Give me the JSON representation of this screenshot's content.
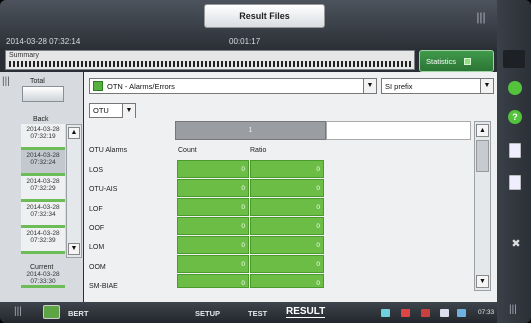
{
  "header": {
    "result_files_label": "Result Files",
    "start_timestamp": "2014-03-28 07:32:14",
    "elapsed": "00:01:17"
  },
  "summary": {
    "label": "Summary"
  },
  "statistics_button": {
    "label": "Statistics"
  },
  "history": {
    "total_label": "Total",
    "back_label": "Back",
    "items": [
      {
        "date": "2014-03-28",
        "time": "07:32:19"
      },
      {
        "date": "2014-03-28",
        "time": "07:32:24"
      },
      {
        "date": "2014-03-28",
        "time": "07:32:29"
      },
      {
        "date": "2014-03-28",
        "time": "07:32:34"
      },
      {
        "date": "2014-03-28",
        "time": "07:32:39"
      }
    ],
    "current_label": "Current",
    "current_date": "2014-03-28",
    "current_time": "07:33:30"
  },
  "selectors": {
    "category": "OTN - Alarms/Errors",
    "prefix": "SI prefix",
    "layer": "OTU"
  },
  "pager": {
    "page": "1"
  },
  "table": {
    "col_alarms": "OTU Alarms",
    "col_count": "Count",
    "col_ratio": "Ratio",
    "rows": [
      {
        "name": "LOS",
        "count": "0",
        "ratio": "0"
      },
      {
        "name": "OTU-AIS",
        "count": "0",
        "ratio": "0"
      },
      {
        "name": "LOF",
        "count": "0",
        "ratio": "0"
      },
      {
        "name": "OOF",
        "count": "0",
        "ratio": "0"
      },
      {
        "name": "LOM",
        "count": "0",
        "ratio": "0"
      },
      {
        "name": "OOM",
        "count": "0",
        "ratio": "0"
      },
      {
        "name": "SM-BIAE",
        "count": "0",
        "ratio": "0"
      }
    ]
  },
  "bottom": {
    "app_name": "BERT",
    "setup": "SETUP",
    "test": "TEST",
    "result": "RESULT",
    "clock": "07:33"
  },
  "colors": {
    "accent_green": "#6bbd45",
    "panel_bg": "#eef0f2",
    "chrome": "#2a2f36"
  }
}
